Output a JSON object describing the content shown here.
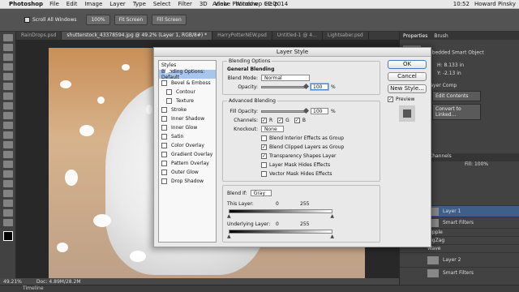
{
  "menubar": {
    "app": "Photoshop",
    "items": [
      "File",
      "Edit",
      "Image",
      "Layer",
      "Type",
      "Select",
      "Filter",
      "3D",
      "View",
      "Window",
      "Help"
    ],
    "window_title": "Adobe Photoshop CC 2014",
    "time": "10:52",
    "user": "Howard Pinsky"
  },
  "options": {
    "scroll_all_windows": "Scroll All Windows",
    "zoom": "100%",
    "fit_screen": "Fit Screen",
    "fill_screen": "Fill Screen"
  },
  "tabs": [
    {
      "label": "RainDrops.psd"
    },
    {
      "label": "shutterstock_43378594.jpg @ 49.2% (Layer 1, RGB/8#) *",
      "active": true
    },
    {
      "label": "HarryPotterNEW.psd"
    },
    {
      "label": "Untitled-1 @ 4..."
    },
    {
      "label": "Lightsaber.psd"
    }
  ],
  "status": {
    "zoom": "49.21%",
    "doc": "Doc: 4.89M/28.2M"
  },
  "timeline": "Timeline",
  "right_panel": {
    "tabs": [
      "Properties",
      "Brush"
    ],
    "object_type": "Embedded Smart Object",
    "h_label": "H:",
    "h_value": "8.133 in",
    "y_label": "Y:",
    "y_value": "-2.13 in",
    "layer_comp": "Layer Comp",
    "edit_contents": "Edit Contents",
    "convert_linked": "Convert to Linked...",
    "channels_tab": "Channels",
    "fill_label": "Fill:",
    "fill_value": "100%",
    "layers": [
      {
        "name": "Layer 1",
        "selected": true
      },
      {
        "name": "Smart Filters"
      },
      {
        "name": "Ripple"
      },
      {
        "name": "ZigZag"
      },
      {
        "name": "Wave"
      },
      {
        "name": "Layer 2"
      },
      {
        "name": "Smart Filters"
      }
    ]
  },
  "dialog": {
    "title": "Layer Style",
    "styles_header": "Styles",
    "styles": [
      {
        "label": "Blending Options: Default",
        "selected": true,
        "checkbox": false
      },
      {
        "label": "Bevel & Emboss",
        "checkbox": true
      },
      {
        "label": "Contour",
        "checkbox": true,
        "indent": true
      },
      {
        "label": "Texture",
        "checkbox": true,
        "indent": true
      },
      {
        "label": "Stroke",
        "checkbox": true
      },
      {
        "label": "Inner Shadow",
        "checkbox": true
      },
      {
        "label": "Inner Glow",
        "checkbox": true
      },
      {
        "label": "Satin",
        "checkbox": true
      },
      {
        "label": "Color Overlay",
        "checkbox": true
      },
      {
        "label": "Gradient Overlay",
        "checkbox": true
      },
      {
        "label": "Pattern Overlay",
        "checkbox": true
      },
      {
        "label": "Outer Glow",
        "checkbox": true
      },
      {
        "label": "Drop Shadow",
        "checkbox": true
      }
    ],
    "blending_options": "Blending Options",
    "general_blending": "General Blending",
    "blend_mode_label": "Blend Mode:",
    "blend_mode_value": "Normal",
    "opacity_label": "Opacity:",
    "opacity_value": "100",
    "percent": "%",
    "advanced_blending": "Advanced Blending",
    "fill_opacity_label": "Fill Opacity:",
    "fill_opacity_value": "100",
    "channels_label": "Channels:",
    "channel_r": "R",
    "channel_g": "G",
    "channel_b": "B",
    "knockout_label": "Knockout:",
    "knockout_value": "None",
    "checks": [
      {
        "label": "Blend Interior Effects as Group",
        "checked": false
      },
      {
        "label": "Blend Clipped Layers as Group",
        "checked": true
      },
      {
        "label": "Transparency Shapes Layer",
        "checked": true
      },
      {
        "label": "Layer Mask Hides Effects",
        "checked": false
      },
      {
        "label": "Vector Mask Hides Effects",
        "checked": false
      }
    ],
    "blend_if_label": "Blend If:",
    "blend_if_value": "Gray",
    "this_layer_label": "This Layer:",
    "underlying_layer_label": "Underlying Layer:",
    "range_min": "0",
    "range_max": "255",
    "ok": "OK",
    "cancel": "Cancel",
    "new_style": "New Style...",
    "preview": "Preview"
  }
}
